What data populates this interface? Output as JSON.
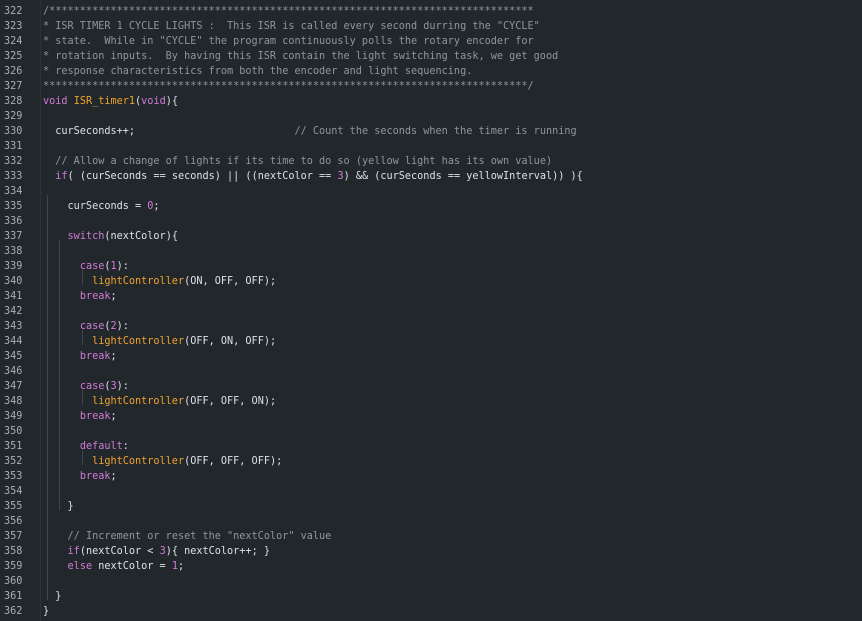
{
  "editor": {
    "colors": {
      "background": "#22272c",
      "line_number": "#a9aeb3",
      "comment": "#8e969d",
      "keyword": "#d07bd6",
      "function": "#f0a32e",
      "default": "#dde1e4"
    },
    "lines": [
      {
        "n": "322",
        "t": [
          {
            "s": "/*******************************************************************************",
            "k": "com"
          }
        ]
      },
      {
        "n": "323",
        "t": [
          {
            "s": "* ISR TIMER 1 CYCLE LIGHTS :  This ISR is called every second durring the \"CYCLE\"",
            "k": "com"
          }
        ]
      },
      {
        "n": "324",
        "t": [
          {
            "s": "* state.  While in \"CYCLE\" the program continuously polls the rotary encoder for",
            "k": "com"
          }
        ]
      },
      {
        "n": "325",
        "t": [
          {
            "s": "* rotation inputs.  By having this ISR contain the light switching task, we get good",
            "k": "com"
          }
        ]
      },
      {
        "n": "326",
        "t": [
          {
            "s": "* response characteristics from both the encoder and light sequencing.",
            "k": "com"
          }
        ]
      },
      {
        "n": "327",
        "t": [
          {
            "s": "*******************************************************************************/",
            "k": "com"
          }
        ]
      },
      {
        "n": "328",
        "t": [
          {
            "s": "void",
            "k": "kw"
          },
          {
            "s": " ",
            "k": "def"
          },
          {
            "s": "ISR_timer1",
            "k": "fn"
          },
          {
            "s": "(",
            "k": "def"
          },
          {
            "s": "void",
            "k": "kw"
          },
          {
            "s": "){",
            "k": "def"
          }
        ]
      },
      {
        "n": "329",
        "t": []
      },
      {
        "n": "330",
        "t": [
          {
            "s": "  curSeconds++;                          ",
            "k": "def"
          },
          {
            "s": "// Count the seconds when the timer is running",
            "k": "com"
          }
        ]
      },
      {
        "n": "331",
        "t": []
      },
      {
        "n": "332",
        "t": [
          {
            "s": "  ",
            "k": "def"
          },
          {
            "s": "// Allow a change of lights if its time to do so (yellow light has its own value)",
            "k": "com"
          }
        ]
      },
      {
        "n": "333",
        "t": [
          {
            "s": "  ",
            "k": "def"
          },
          {
            "s": "if",
            "k": "kw"
          },
          {
            "s": "( (curSeconds == seconds) || ((nextColor == ",
            "k": "def"
          },
          {
            "s": "3",
            "k": "num"
          },
          {
            "s": ") && (curSeconds == yellowInterval)) ){",
            "k": "def"
          }
        ]
      },
      {
        "n": "334",
        "t": []
      },
      {
        "n": "335",
        "t": [
          {
            "s": "    curSeconds = ",
            "k": "def"
          },
          {
            "s": "0",
            "k": "num"
          },
          {
            "s": ";",
            "k": "def"
          }
        ]
      },
      {
        "n": "336",
        "t": []
      },
      {
        "n": "337",
        "t": [
          {
            "s": "    ",
            "k": "def"
          },
          {
            "s": "switch",
            "k": "kw"
          },
          {
            "s": "(nextColor){",
            "k": "def"
          }
        ]
      },
      {
        "n": "338",
        "t": []
      },
      {
        "n": "339",
        "t": [
          {
            "s": "      ",
            "k": "def"
          },
          {
            "s": "case",
            "k": "kw"
          },
          {
            "s": "(",
            "k": "def"
          },
          {
            "s": "1",
            "k": "num"
          },
          {
            "s": "):",
            "k": "def"
          }
        ]
      },
      {
        "n": "340",
        "t": [
          {
            "s": "        ",
            "k": "def"
          },
          {
            "s": "lightController",
            "k": "fn"
          },
          {
            "s": "(ON, OFF, OFF);",
            "k": "def"
          }
        ]
      },
      {
        "n": "341",
        "t": [
          {
            "s": "      ",
            "k": "def"
          },
          {
            "s": "break",
            "k": "kw"
          },
          {
            "s": ";",
            "k": "def"
          }
        ]
      },
      {
        "n": "342",
        "t": []
      },
      {
        "n": "343",
        "t": [
          {
            "s": "      ",
            "k": "def"
          },
          {
            "s": "case",
            "k": "kw"
          },
          {
            "s": "(",
            "k": "def"
          },
          {
            "s": "2",
            "k": "num"
          },
          {
            "s": "):",
            "k": "def"
          }
        ]
      },
      {
        "n": "344",
        "t": [
          {
            "s": "        ",
            "k": "def"
          },
          {
            "s": "lightController",
            "k": "fn"
          },
          {
            "s": "(OFF, ON, OFF);",
            "k": "def"
          }
        ]
      },
      {
        "n": "345",
        "t": [
          {
            "s": "      ",
            "k": "def"
          },
          {
            "s": "break",
            "k": "kw"
          },
          {
            "s": ";",
            "k": "def"
          }
        ]
      },
      {
        "n": "346",
        "t": []
      },
      {
        "n": "347",
        "t": [
          {
            "s": "      ",
            "k": "def"
          },
          {
            "s": "case",
            "k": "kw"
          },
          {
            "s": "(",
            "k": "def"
          },
          {
            "s": "3",
            "k": "num"
          },
          {
            "s": "):",
            "k": "def"
          }
        ]
      },
      {
        "n": "348",
        "t": [
          {
            "s": "        ",
            "k": "def"
          },
          {
            "s": "lightController",
            "k": "fn"
          },
          {
            "s": "(OFF, OFF, ON);",
            "k": "def"
          }
        ]
      },
      {
        "n": "349",
        "t": [
          {
            "s": "      ",
            "k": "def"
          },
          {
            "s": "break",
            "k": "kw"
          },
          {
            "s": ";",
            "k": "def"
          }
        ]
      },
      {
        "n": "350",
        "t": []
      },
      {
        "n": "351",
        "t": [
          {
            "s": "      ",
            "k": "def"
          },
          {
            "s": "default",
            "k": "kw"
          },
          {
            "s": ":",
            "k": "def"
          }
        ]
      },
      {
        "n": "352",
        "t": [
          {
            "s": "        ",
            "k": "def"
          },
          {
            "s": "lightController",
            "k": "fn"
          },
          {
            "s": "(OFF, OFF, OFF);",
            "k": "def"
          }
        ]
      },
      {
        "n": "353",
        "t": [
          {
            "s": "      ",
            "k": "def"
          },
          {
            "s": "break",
            "k": "kw"
          },
          {
            "s": ";",
            "k": "def"
          }
        ]
      },
      {
        "n": "354",
        "t": []
      },
      {
        "n": "355",
        "t": [
          {
            "s": "    }",
            "k": "def"
          }
        ]
      },
      {
        "n": "356",
        "t": []
      },
      {
        "n": "357",
        "t": [
          {
            "s": "    ",
            "k": "def"
          },
          {
            "s": "// Increment or reset the \"nextColor\" value",
            "k": "com"
          }
        ]
      },
      {
        "n": "358",
        "t": [
          {
            "s": "    ",
            "k": "def"
          },
          {
            "s": "if",
            "k": "kw"
          },
          {
            "s": "(nextColor < ",
            "k": "def"
          },
          {
            "s": "3",
            "k": "num"
          },
          {
            "s": "){ nextColor++; }",
            "k": "def"
          }
        ]
      },
      {
        "n": "359",
        "t": [
          {
            "s": "    ",
            "k": "def"
          },
          {
            "s": "else",
            "k": "kw"
          },
          {
            "s": " nextColor = ",
            "k": "def"
          },
          {
            "s": "1",
            "k": "num"
          },
          {
            "s": ";",
            "k": "def"
          }
        ]
      },
      {
        "n": "360",
        "t": []
      },
      {
        "n": "361",
        "t": [
          {
            "s": "  }",
            "k": "def"
          }
        ]
      },
      {
        "n": "362",
        "t": [
          {
            "s": "}",
            "k": "def"
          }
        ]
      }
    ]
  }
}
